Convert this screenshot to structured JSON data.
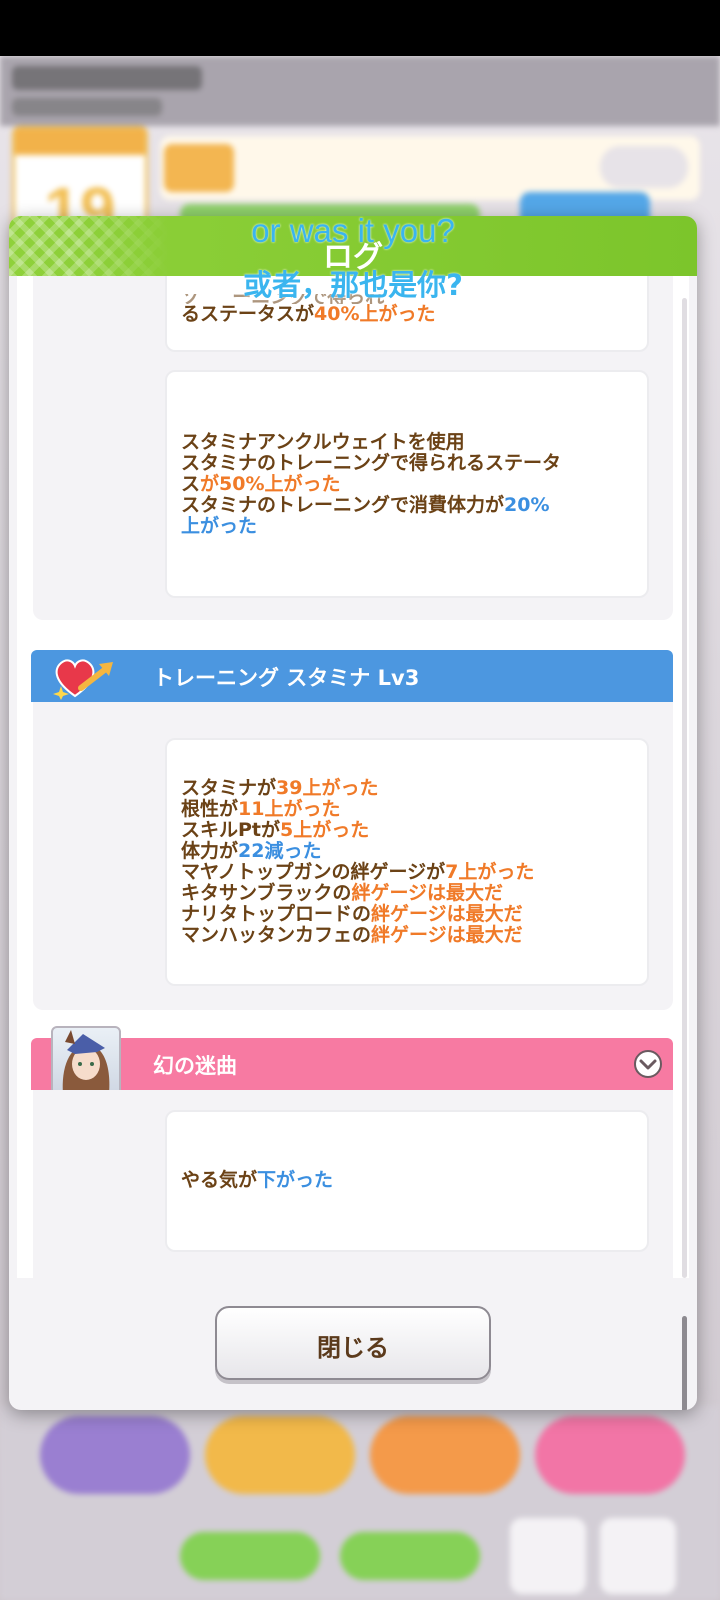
{
  "background": {
    "calendar_day": "19"
  },
  "subtitles": {
    "english": "or was it you?",
    "chinese": "或者，那也是你?"
  },
  "modal": {
    "title": "ログ",
    "close_label": "閉じる"
  },
  "entries": {
    "partial_top": {
      "line1_cut": "ソ 　 ーニングで得られ",
      "line2_a": "るステータスが",
      "line2_b": "40%上がった"
    },
    "ankle_weight": {
      "l1": "スタミナアンクルウェイトを使用",
      "l2": "スタミナのトレーニングで得られるステータ",
      "l3_a": "ス",
      "l3_b": "が",
      "l3_c": "50%上がった",
      "l4_a": "スタミナのトレーニングで消費体力が",
      "l4_b": "20%",
      "l5": "上がった"
    }
  },
  "training": {
    "header": "トレーニング スタミナ Lv3",
    "lines": [
      {
        "a": "スタミナが",
        "b": "39上がった",
        "style": "o"
      },
      {
        "a": "根性が",
        "b": "11上がった",
        "style": "o"
      },
      {
        "a": "スキルPtが",
        "b": "5上がった",
        "style": "o"
      },
      {
        "a": "体力が",
        "b": "22減った",
        "style": "b"
      },
      {
        "a": "マヤノトップガンの絆ゲージが",
        "b": "7上がった",
        "style": "o"
      },
      {
        "a": "キタサンブラックの",
        "b": "絆ゲージは最大だ",
        "style": "o"
      },
      {
        "a": "ナリタトップロードの",
        "b": "絆ゲージは最大だ",
        "style": "o"
      },
      {
        "a": "マンハッタンカフェの",
        "b": "絆ゲージは最大だ",
        "style": "o"
      }
    ]
  },
  "event": {
    "header": "幻の迷曲",
    "line_a": "やる気が",
    "line_b": "下がった"
  },
  "colors": {
    "header_green": "#8fd13a",
    "training_blue": "#4c97e0",
    "event_pink": "#f77aa2",
    "up_orange": "#f07a28",
    "down_blue": "#3b8fe0",
    "text_brown": "#6b4216"
  }
}
